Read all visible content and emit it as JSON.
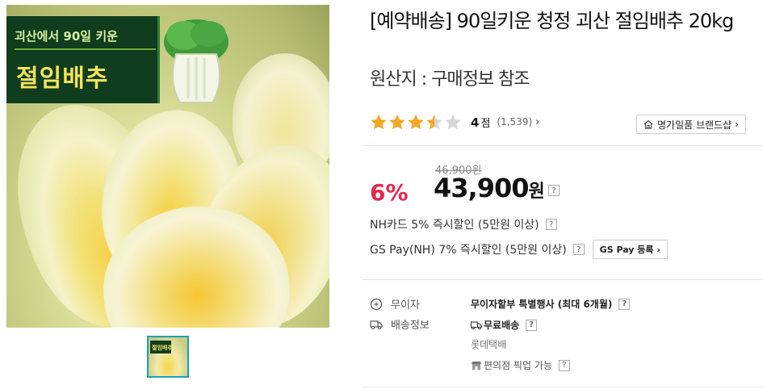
{
  "gallery": {
    "promo_top": "괴산에서 90일 키운",
    "promo_main": "절임배추",
    "thumb_text": "절임배추"
  },
  "product": {
    "title": "[예약배송] 90일키운 청정 괴산 절임배추 20kg",
    "origin": "원산지 : 구매정보 참조"
  },
  "rating": {
    "stars": 3.5,
    "max_stars": 5,
    "score": "4",
    "score_unit": "점",
    "review_count": "(1,539)",
    "chevron": "›"
  },
  "brand_shop": {
    "label": "명가일품 브랜드샵",
    "chevron": "›"
  },
  "pricing": {
    "discount": "6%",
    "original_price": "46,900원",
    "price": "43,900",
    "price_unit": "원",
    "help": "?"
  },
  "promotions": [
    {
      "text": "NH카드 5% 즉시할인 (5만원 이상)"
    },
    {
      "text": "GS Pay(NH) 7% 즉시할인 (5만원 이상)",
      "button": "GS Pay 등록 ›"
    }
  ],
  "info": {
    "installment_label": "무이자",
    "installment_value": "무이자할부 특별행사 (최대 6개월)",
    "shipping_label": "배송정보",
    "shipping_value": "무료배송",
    "courier": "롯데택배",
    "pickup": "편의점 픽업 가능"
  },
  "colors": {
    "discount": "#e8264c",
    "star": "#f5a623",
    "star_empty": "#d6d6d6",
    "thumb_border": "#1aa0b8",
    "promo_bg": "#0f3d1e",
    "promo_text": "#f6e25c"
  },
  "icons": [
    "star-icon",
    "home-icon",
    "help-icon",
    "coin-icon",
    "truck-icon",
    "store-icon",
    "chevron-right-icon",
    "cabbage-leaf-icon"
  ]
}
